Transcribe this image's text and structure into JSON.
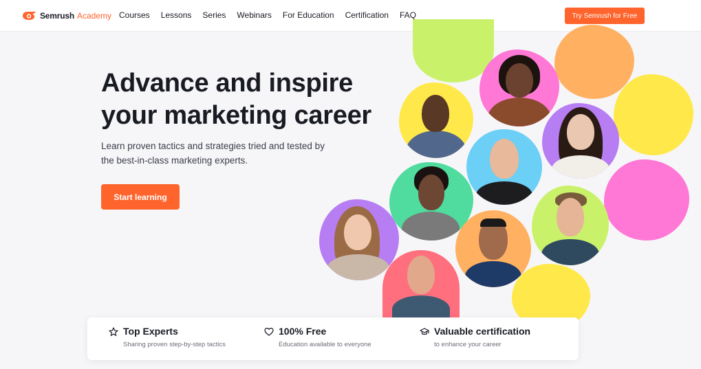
{
  "header": {
    "brand": "Semrush",
    "brand_sub": "Academy",
    "nav": [
      "Courses",
      "Lessons",
      "Series",
      "Webinars",
      "For Education",
      "Certification",
      "FAQ"
    ],
    "cta": "Try Semrush for Free"
  },
  "hero": {
    "title_line1": "Advance and inspire",
    "title_line2": "your marketing career",
    "subtitle_line1": "Learn proven tactics and strategies tried and tested by",
    "subtitle_line2": "the best-in-class marketing experts.",
    "button": "Start learning"
  },
  "features": [
    {
      "icon": "star-icon",
      "title": "Top Experts",
      "subtitle": "Sharing proven step-by-step tactics"
    },
    {
      "icon": "heart-icon",
      "title": "100% Free",
      "subtitle": "Education available to everyone"
    },
    {
      "icon": "graduation-cap-icon",
      "title": "Valuable certification",
      "subtitle": "to enhance your career"
    }
  ],
  "colors": {
    "accent": "#ff642d",
    "lime": "#c9f26a",
    "orange": "#ffb061",
    "yellow": "#ffe94a",
    "pink": "#ff78d6",
    "purple": "#b77df2",
    "sky": "#6ccff6",
    "green": "#4fdc9e",
    "rose": "#ff6f7d"
  }
}
